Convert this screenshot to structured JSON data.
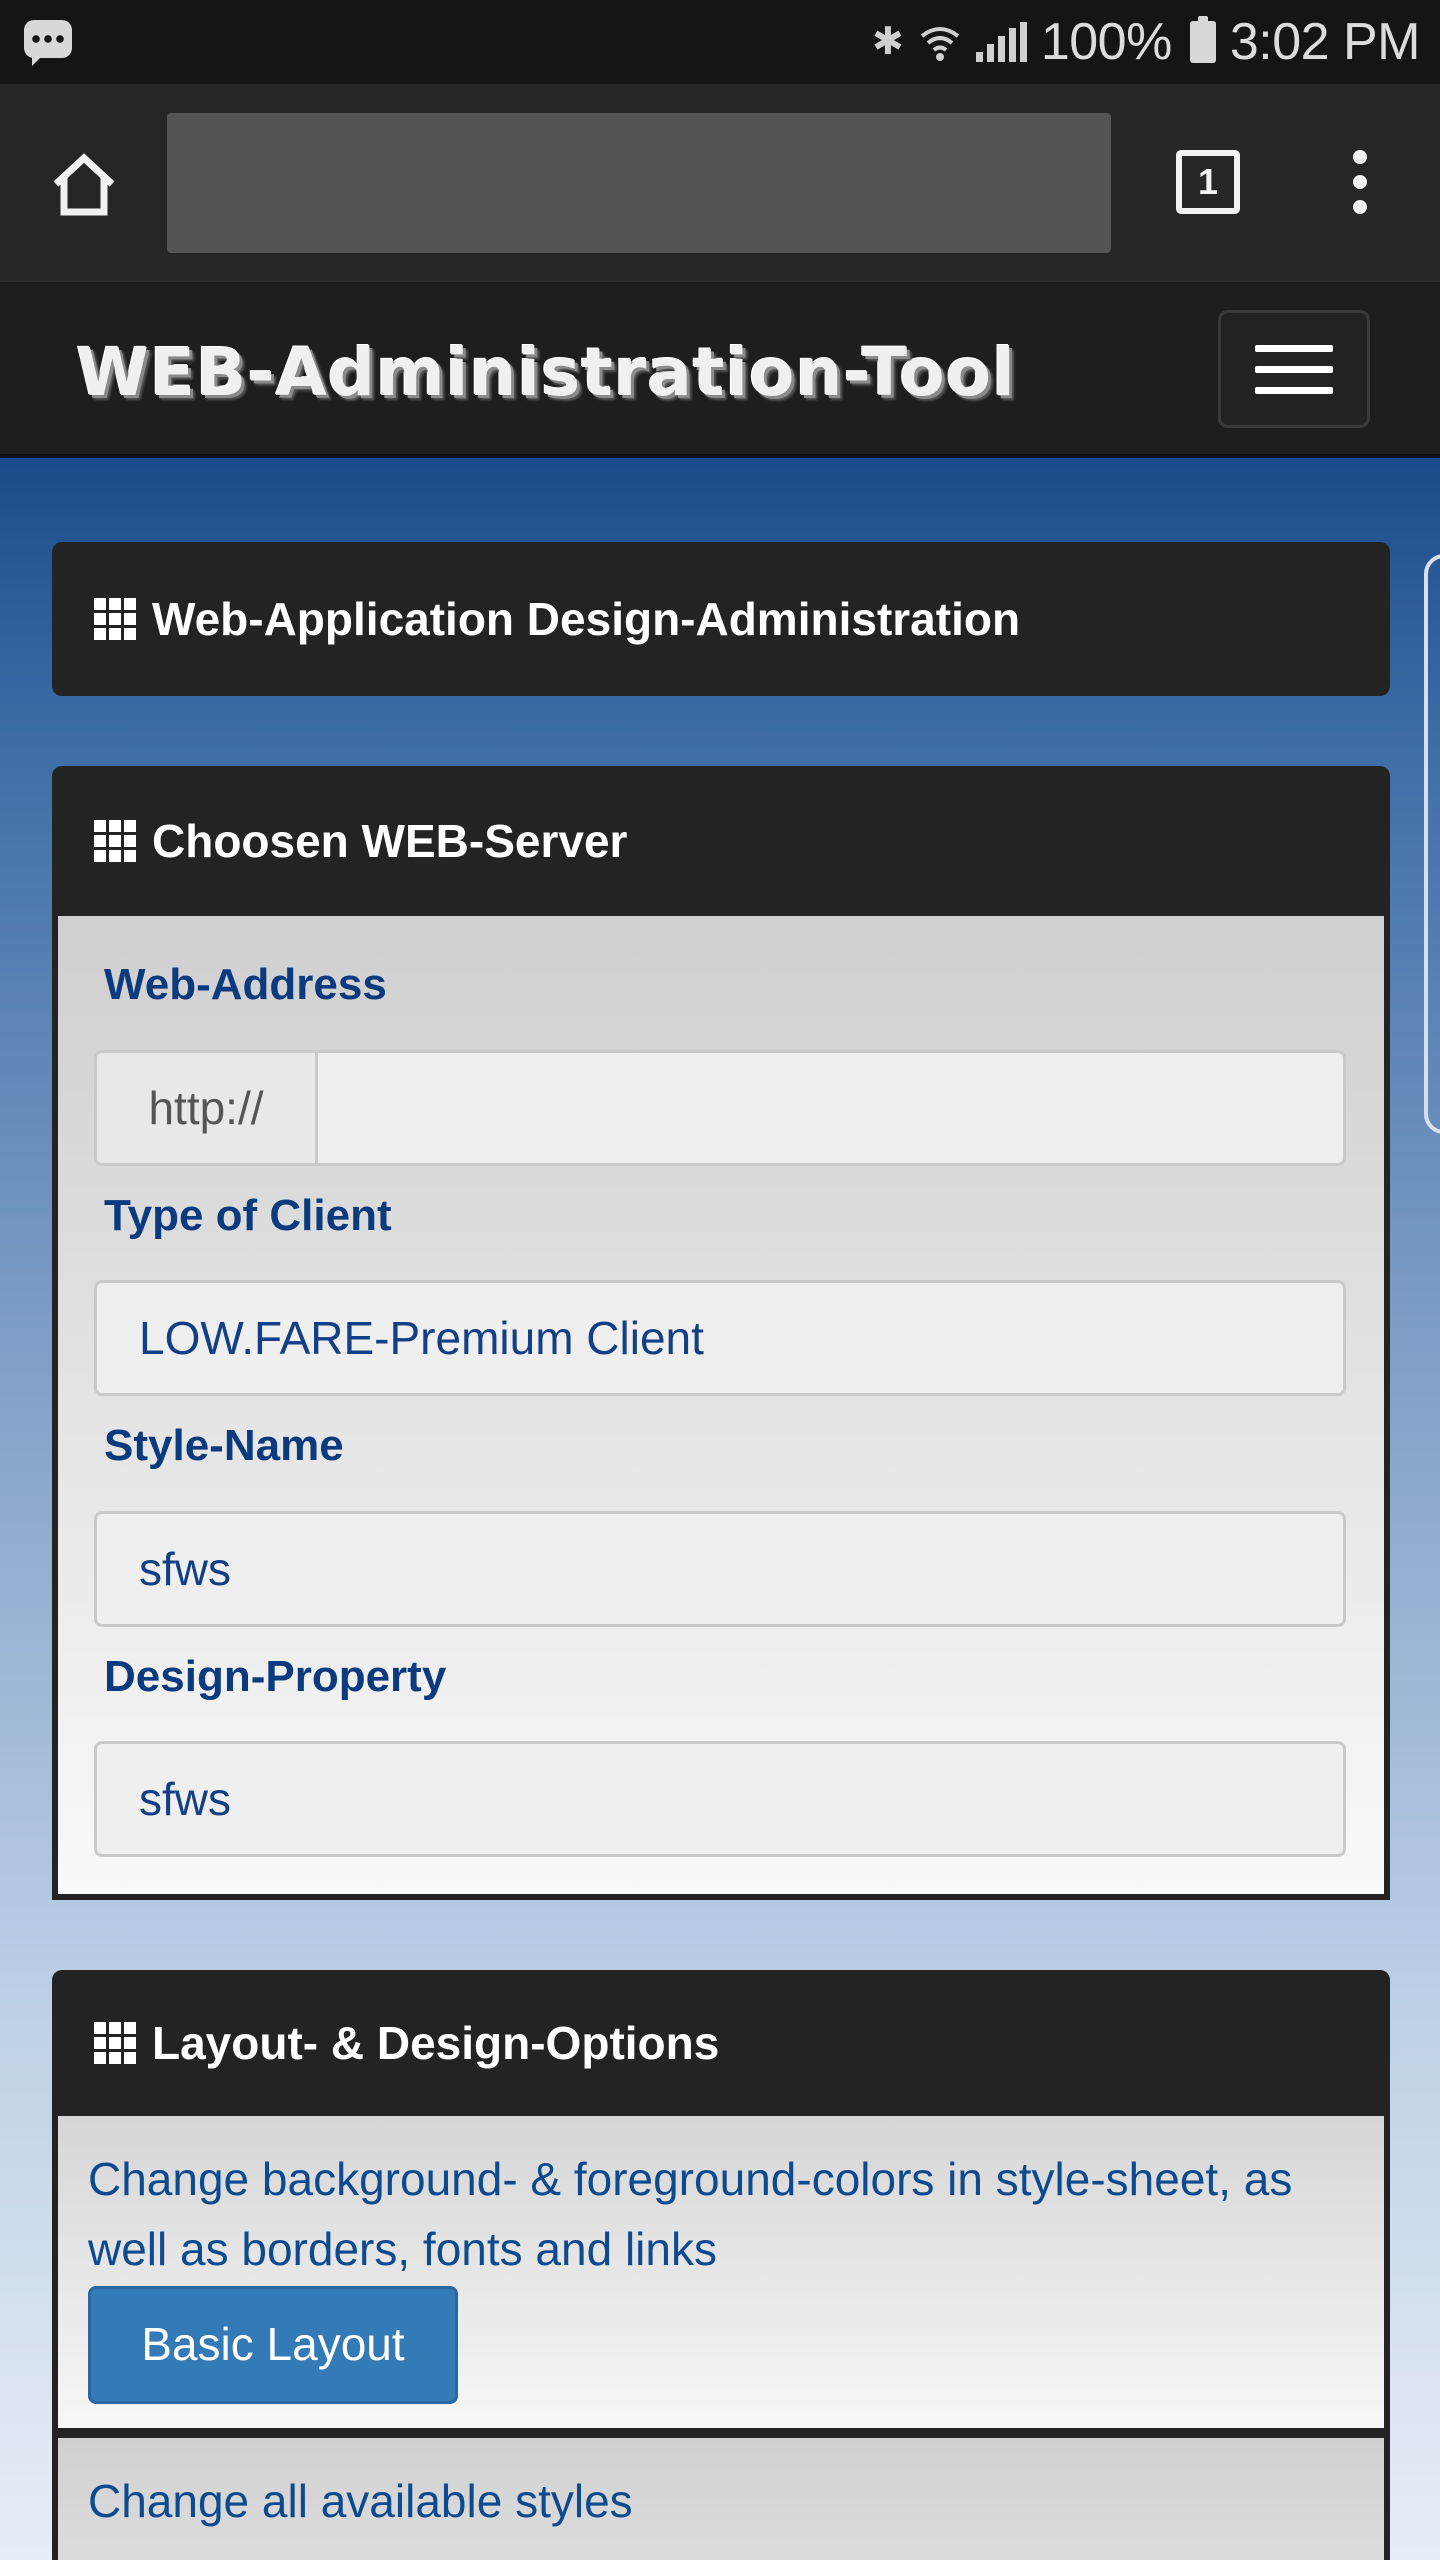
{
  "status_bar": {
    "battery": "100%",
    "time": "3:02 PM",
    "icons": [
      "message-icon",
      "bluetooth-icon",
      "wifi-icon",
      "signal-icon",
      "battery-icon"
    ]
  },
  "browser": {
    "url": "",
    "tab_count": "1",
    "icons": [
      "home-icon",
      "tabs-icon",
      "overflow-menu-icon"
    ]
  },
  "navbar": {
    "brand": "WEB-Administration-Tool",
    "toggle_icon": "hamburger-icon"
  },
  "panels": {
    "design_admin": {
      "title": "Web-Application Design-Administration",
      "icon": "grid-icon"
    },
    "server": {
      "title": "Choosen WEB-Server",
      "icon": "grid-icon",
      "fields": {
        "web_address": {
          "label": "Web-Address",
          "prefix": "http://",
          "value": ""
        },
        "client_type": {
          "label": "Type of Client",
          "value": "LOW.FARE-Premium Client"
        },
        "style_name": {
          "label": "Style-Name",
          "value": "sfws"
        },
        "design_property": {
          "label": "Design-Property",
          "value": "sfws"
        }
      }
    },
    "layout": {
      "title": "Layout- & Design-Options",
      "icon": "grid-icon",
      "description": "Change background- & foreground-colors in style-sheet, as well as borders, fonts and links",
      "button": "Basic Layout",
      "description2": "Change all available styles"
    }
  },
  "colors": {
    "accent_button": "#337ab7",
    "label_text": "#0b3a7e",
    "panel_header": "#232323"
  }
}
